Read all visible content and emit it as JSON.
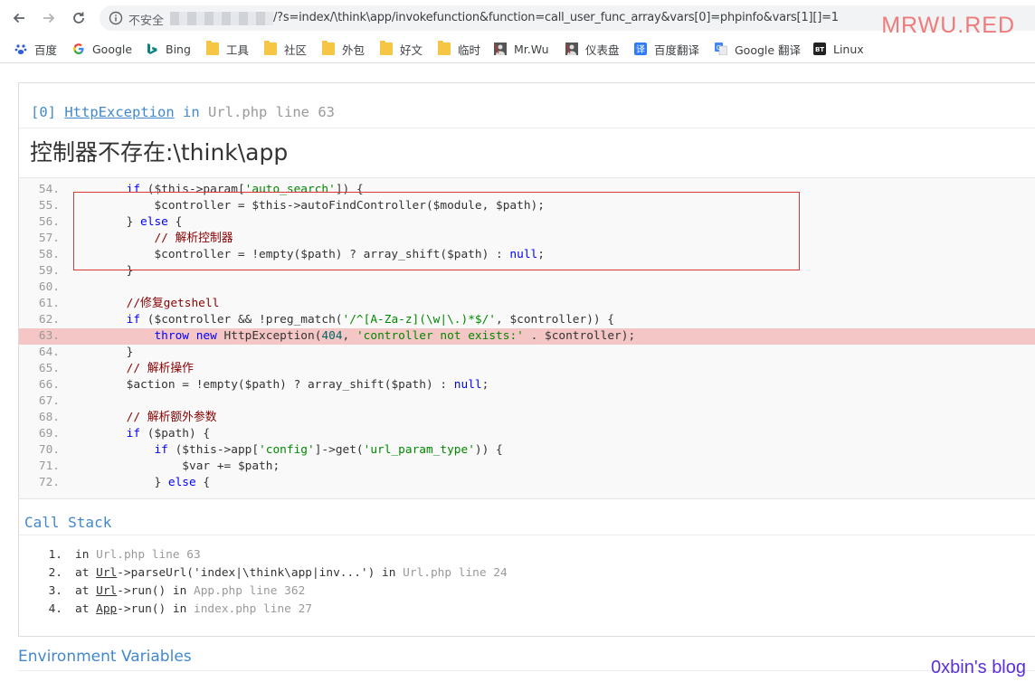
{
  "browser": {
    "insecure_label": "不安全",
    "url_path": "/?s=index/\\think\\app/invokefunction&function=call_user_func_array&vars[0]=phpinfo&vars[1][]=1",
    "watermark": "MRWU.RED"
  },
  "bookmarks": [
    {
      "label": "百度",
      "icon": "baidu-icon"
    },
    {
      "label": "Google",
      "icon": "google-icon"
    },
    {
      "label": "Bing",
      "icon": "bing-icon"
    },
    {
      "label": "工具",
      "icon": "folder-icon"
    },
    {
      "label": "社区",
      "icon": "folder-icon"
    },
    {
      "label": "外包",
      "icon": "folder-icon"
    },
    {
      "label": "好文",
      "icon": "folder-icon"
    },
    {
      "label": "临时",
      "icon": "folder-icon"
    },
    {
      "label": "Mr.Wu",
      "icon": "avatar-icon"
    },
    {
      "label": "仪表盘",
      "icon": "avatar-icon"
    },
    {
      "label": "百度翻译",
      "icon": "translate-icon"
    },
    {
      "label": "Google 翻译",
      "icon": "google-translate-icon"
    },
    {
      "label": "Linux",
      "icon": "bt-icon"
    }
  ],
  "exception": {
    "index": "[0]",
    "class": "HttpException",
    "in_word": "in",
    "location": "Url.php line 63",
    "message": "控制器不存在:\\think\\app"
  },
  "source": [
    {
      "n": "54.",
      "code": "        if ($this->param['auto_search']) {"
    },
    {
      "n": "55.",
      "code": "            $controller = $this->autoFindController($module, $path);"
    },
    {
      "n": "56.",
      "code": "        } else {"
    },
    {
      "n": "57.",
      "code": "            // 解析控制器"
    },
    {
      "n": "58.",
      "code": "            $controller = !empty($path) ? array_shift($path) : null;"
    },
    {
      "n": "59.",
      "code": "        }"
    },
    {
      "n": "60.",
      "code": ""
    },
    {
      "n": "61.",
      "code": "        //修复getshell"
    },
    {
      "n": "62.",
      "code": "        if ($controller && !preg_match('/^[A-Za-z](\\w|\\.)*$/', $controller)) {"
    },
    {
      "n": "63.",
      "code": "            throw new HttpException(404, 'controller not exists:' . $controller);"
    },
    {
      "n": "64.",
      "code": "        }"
    },
    {
      "n": "65.",
      "code": "        // 解析操作"
    },
    {
      "n": "66.",
      "code": "        $action = !empty($path) ? array_shift($path) : null;"
    },
    {
      "n": "67.",
      "code": ""
    },
    {
      "n": "68.",
      "code": "        // 解析额外参数"
    },
    {
      "n": "69.",
      "code": "        if ($path) {"
    },
    {
      "n": "70.",
      "code": "            if ($this->app['config']->get('url_param_type')) {"
    },
    {
      "n": "71.",
      "code": "                $var += $path;"
    },
    {
      "n": "72.",
      "code": "            } else {"
    }
  ],
  "highlight_line": "63.",
  "call_stack": {
    "title": "Call Stack",
    "items": [
      {
        "n": "1.",
        "text": "in Url.php line 63"
      },
      {
        "n": "2.",
        "text": "at Url->parseUrl('index|\\think\\app|inv...') in Url.php line 24"
      },
      {
        "n": "3.",
        "text": "at Url->run() in App.php line 362"
      },
      {
        "n": "4.",
        "text": "at App->run() in index.php line 27"
      }
    ]
  },
  "env_title": "Environment Variables",
  "blog_watermark": "0xbin's blog",
  "colors": {
    "link": "#4288ce",
    "highlight": "#f5c6c6",
    "box": "#d9383a"
  }
}
